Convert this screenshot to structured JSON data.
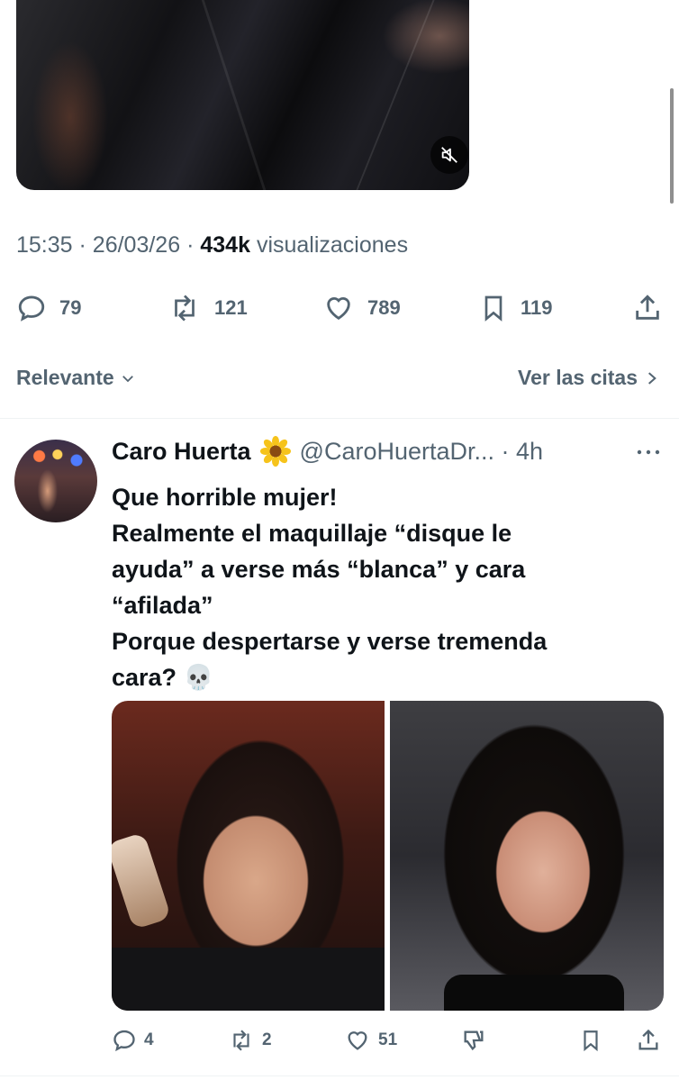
{
  "tweet": {
    "time": "15:35",
    "date": "26/03/26",
    "views_count": "434k",
    "views_label": "visualizaciones",
    "actions": {
      "replies": "79",
      "reposts": "121",
      "likes": "789",
      "bookmarks": "119"
    }
  },
  "replies_controls": {
    "sort_label": "Relevante",
    "quotes_link": "Ver las citas"
  },
  "reply": {
    "name": "Caro Huerta",
    "handle": "@CaroHuertaDr...",
    "time": "4h",
    "text_lines": [
      "Que horrible mujer!",
      "Realmente el maquillaje “disque le",
      "ayuda” a verse más “blanca” y cara",
      "“afilada”",
      "Porque despertarse y verse tremenda",
      "cara?"
    ],
    "emoji": "💀",
    "actions": {
      "replies": "4",
      "reposts": "2",
      "likes": "51"
    }
  },
  "icons": {
    "mute": "volume-off-icon",
    "reply": "comment-icon",
    "repost": "repost-icon",
    "like": "heart-icon",
    "bookmark": "bookmark-icon",
    "share": "share-icon",
    "dislike": "thumbs-down-icon",
    "more": "more-icon",
    "badge": "sunflower-icon"
  },
  "colors": {
    "text": "#0f1419",
    "muted": "#536471",
    "divider": "#eff3f4"
  }
}
